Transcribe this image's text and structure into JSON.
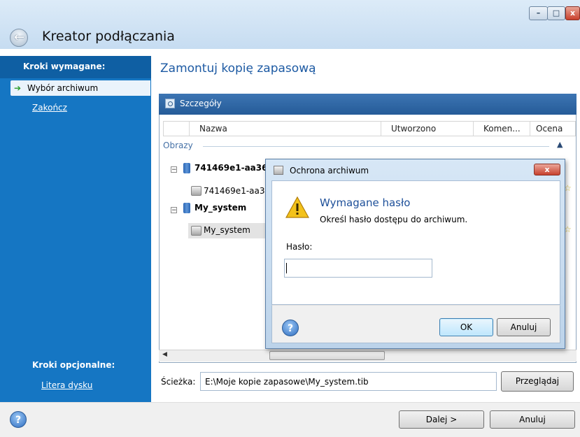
{
  "window": {
    "title": "Kreator podłączania",
    "minimize": "–",
    "maximize": "□",
    "close": "x"
  },
  "sidebar": {
    "required_header": "Kroki wymagane:",
    "items": [
      {
        "label": "Wybór archiwum"
      },
      {
        "label": "Zakończ"
      }
    ],
    "optional_header": "Kroki opcjonalne:",
    "optional_items": [
      {
        "label": "Litera dysku"
      }
    ]
  },
  "main": {
    "title": "Zamontuj kopię zapasową",
    "details_header": "Szczegóły",
    "columns": [
      "Nazwa",
      "Utworzono",
      "Komen...",
      "Ocena"
    ],
    "group_label": "Obrazy",
    "rows": [
      {
        "name": "741469e1-aa36",
        "bold": true,
        "expander": "−"
      },
      {
        "name": "741469e1-aa36",
        "bold": false
      },
      {
        "name": "My_system",
        "bold": true,
        "expander": "−"
      },
      {
        "name": "My_system",
        "bold": false
      }
    ],
    "path_label": "Ścieżka:",
    "path_value": "E:\\Moje kopie zapasowe\\My_system.tib",
    "browse_button": "Przeglądaj"
  },
  "footer": {
    "help": "?",
    "next_button": "Dalej >",
    "cancel_button": "Anuluj"
  },
  "dialog": {
    "title": "Ochrona archiwum",
    "close": "x",
    "heading": "Wymagane hasło",
    "message": "Określ hasło dostępu do archiwum.",
    "password_label": "Hasło:",
    "password_value": "",
    "help": "?",
    "ok_button": "OK",
    "cancel_button": "Anuluj"
  }
}
